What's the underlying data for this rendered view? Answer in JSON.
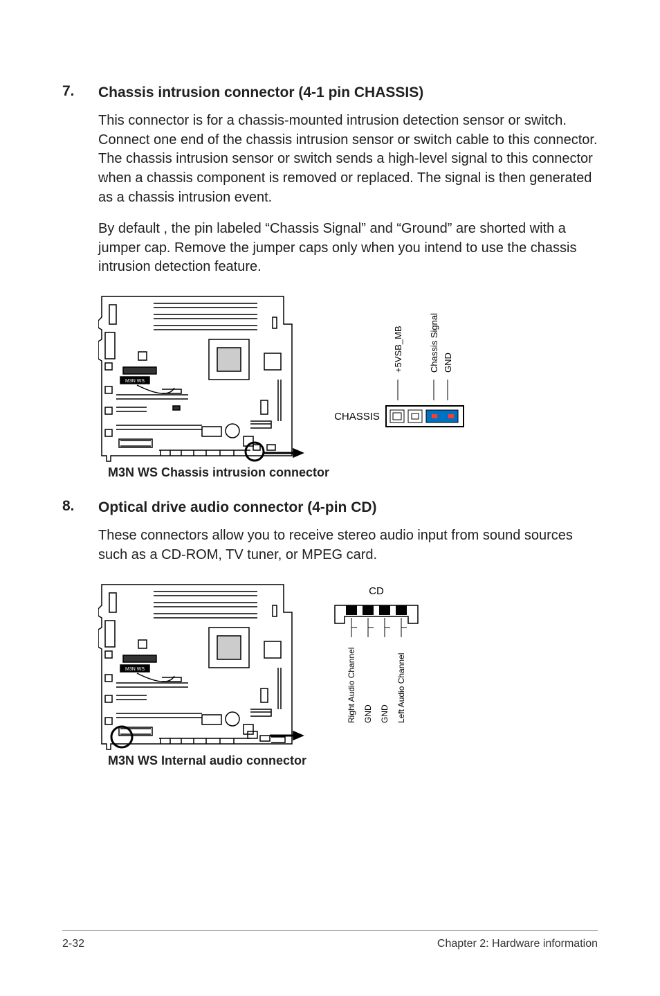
{
  "section7": {
    "num": "7.",
    "title": "Chassis intrusion connector (4-1 pin CHASSIS)",
    "p1": "This connector is for a chassis-mounted intrusion detection sensor or switch. Connect one end of the chassis intrusion sensor or switch cable to this connector. The chassis intrusion sensor or switch sends a high-level signal to this connector when a chassis component is removed or replaced. The signal is then generated as a chassis intrusion event.",
    "p2": "By default , the pin labeled “Chassis Signal” and “Ground” are shorted with a jumper cap. Remove the jumper caps only when you intend to use the chassis intrusion detection feature.",
    "caption": "M3N WS Chassis intrusion connector",
    "connector_label": "CHASSIS",
    "board_label": "M3N WS",
    "pins": [
      "+5VSB_MB",
      "Chassis Signal",
      "GND"
    ]
  },
  "section8": {
    "num": "8.",
    "title": "Optical drive audio connector (4-pin CD)",
    "p1": "These connectors allow you to receive stereo audio input from sound sources such as a CD-ROM, TV tuner, or MPEG card.",
    "caption": "M3N WS Internal audio connector",
    "connector_label": "CD",
    "board_label": "M3N WS",
    "pins": [
      "Right Audio Channel",
      "GND",
      "GND",
      "Left Audio Channel"
    ]
  },
  "footer": {
    "left": "2-32",
    "right": "Chapter 2: Hardware information"
  }
}
